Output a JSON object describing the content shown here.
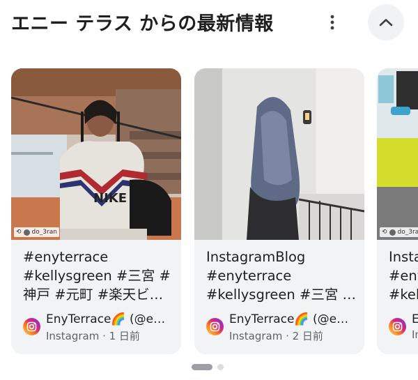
{
  "header": {
    "title": "エニー テラス からの最新情報"
  },
  "cards": [
    {
      "lines": [
        "#enyterrace",
        "#kellysgreen #三宮 #",
        "神戸 #元町 #楽天ビ…"
      ],
      "source_name": "EnyTerrace🌈 (@e…",
      "platform": "Instagram",
      "age": "1 日前",
      "image_credit": "do_3ran"
    },
    {
      "lines": [
        "InstagramBlog",
        "#enyterrace",
        "#kellysgreen #三宮 #…"
      ],
      "source_name": "EnyTerrace🌈 (@e…",
      "platform": "Instagram",
      "age": "2 日前"
    },
    {
      "lines": [
        "Insta",
        "#eny",
        "#kel"
      ],
      "source_name": "E",
      "platform": "In",
      "age": "",
      "image_credit": "do_3ra"
    }
  ],
  "pager": {
    "count": 2,
    "active": 1
  },
  "icons": {
    "more": "more-vert-icon",
    "collapse": "chevron-up-icon",
    "source": "instagram-icon"
  },
  "colors": {
    "card_bg": "#f1f3f4",
    "meta_text": "#5f6368",
    "button_bg": "#f0f2f4"
  }
}
